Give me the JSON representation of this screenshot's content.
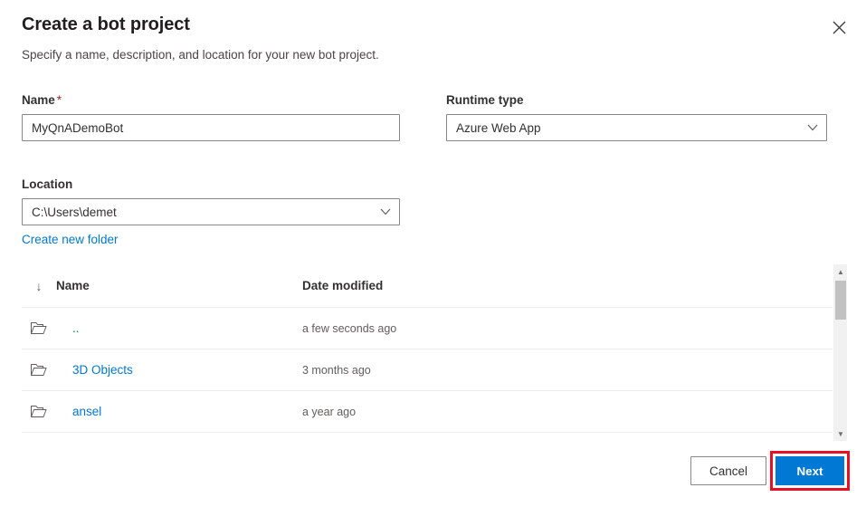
{
  "dialog": {
    "title": "Create a bot project",
    "subtitle": "Specify a name, description, and location for your new bot project.",
    "close_icon": "close-icon"
  },
  "form": {
    "name": {
      "label": "Name",
      "required_marker": "*",
      "value": "MyQnADemoBot",
      "placeholder": ""
    },
    "runtime_type": {
      "label": "Runtime type",
      "value": "Azure Web App",
      "chevron_icon": "chevron-down-icon"
    },
    "location": {
      "label": "Location",
      "value": "C:\\Users\\demet",
      "chevron_icon": "chevron-down-icon"
    },
    "create_folder_link": "Create new folder"
  },
  "file_browser": {
    "sort_indicator": "↓",
    "columns": {
      "name": "Name",
      "date_modified": "Date modified"
    },
    "rows": [
      {
        "icon": "folder-icon",
        "name": "..",
        "date_modified": "a few seconds ago"
      },
      {
        "icon": "folder-icon",
        "name": "3D Objects",
        "date_modified": "3 months ago"
      },
      {
        "icon": "folder-icon",
        "name": "ansel",
        "date_modified": "a year ago"
      }
    ],
    "scrollbar": {
      "up_arrow": "▲",
      "down_arrow": "▼"
    }
  },
  "footer": {
    "cancel_label": "Cancel",
    "next_label": "Next"
  },
  "colors": {
    "accent": "#0078d4",
    "link": "#0078d4",
    "required": "#a4262c",
    "highlight": "#e81123",
    "border": "#8a8886",
    "divider": "#edebe9"
  }
}
